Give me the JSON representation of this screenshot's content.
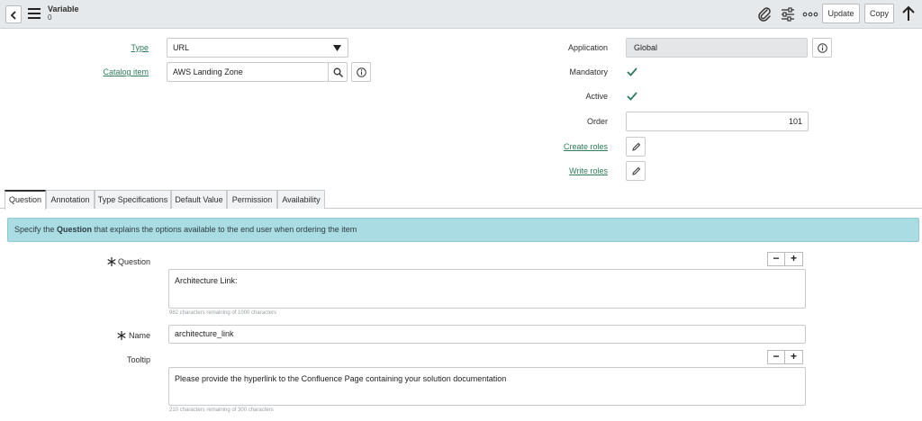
{
  "header": {
    "title": "Variable",
    "subtitle": "0",
    "update_label": "Update",
    "copy_label": "Copy",
    "icons": [
      "paperclip-icon",
      "sliders-icon",
      "more-icon",
      "arrow-up-icon"
    ]
  },
  "form": {
    "type_label": "Type",
    "type_value": "URL",
    "catalog_item_label": "Catalog item",
    "catalog_item_value": "AWS Landing Zone",
    "application_label": "Application",
    "application_value": "Global",
    "mandatory_label": "Mandatory",
    "mandatory_checked": true,
    "active_label": "Active",
    "active_checked": true,
    "order_label": "Order",
    "order_value": "101",
    "create_roles_label": "Create roles",
    "write_roles_label": "Write roles"
  },
  "tabs": [
    {
      "label": "Question",
      "active": true
    },
    {
      "label": "Annotation",
      "active": false
    },
    {
      "label": "Type Specifications",
      "active": false
    },
    {
      "label": "Default Value",
      "active": false
    },
    {
      "label": "Permission",
      "active": false
    },
    {
      "label": "Availability",
      "active": false
    }
  ],
  "banner": {
    "prefix": "Specify the ",
    "bold": "Question",
    "suffix": " that explains the options available to the end user when ordering the item"
  },
  "question": {
    "label": "Question",
    "value": "Architecture Link:",
    "counter": "982 characters remaining of 1000 characters"
  },
  "name": {
    "label": "Name",
    "value": "architecture_link"
  },
  "tooltip": {
    "label": "Tooltip",
    "value": "Please provide the hyperlink to the Confluence Page containing your solution documentation",
    "counter": "210 characters remaining of 300 characters"
  },
  "colors": {
    "link": "#2e7d5b",
    "banner": "#a9dde3",
    "check": "#2e7d5b"
  }
}
